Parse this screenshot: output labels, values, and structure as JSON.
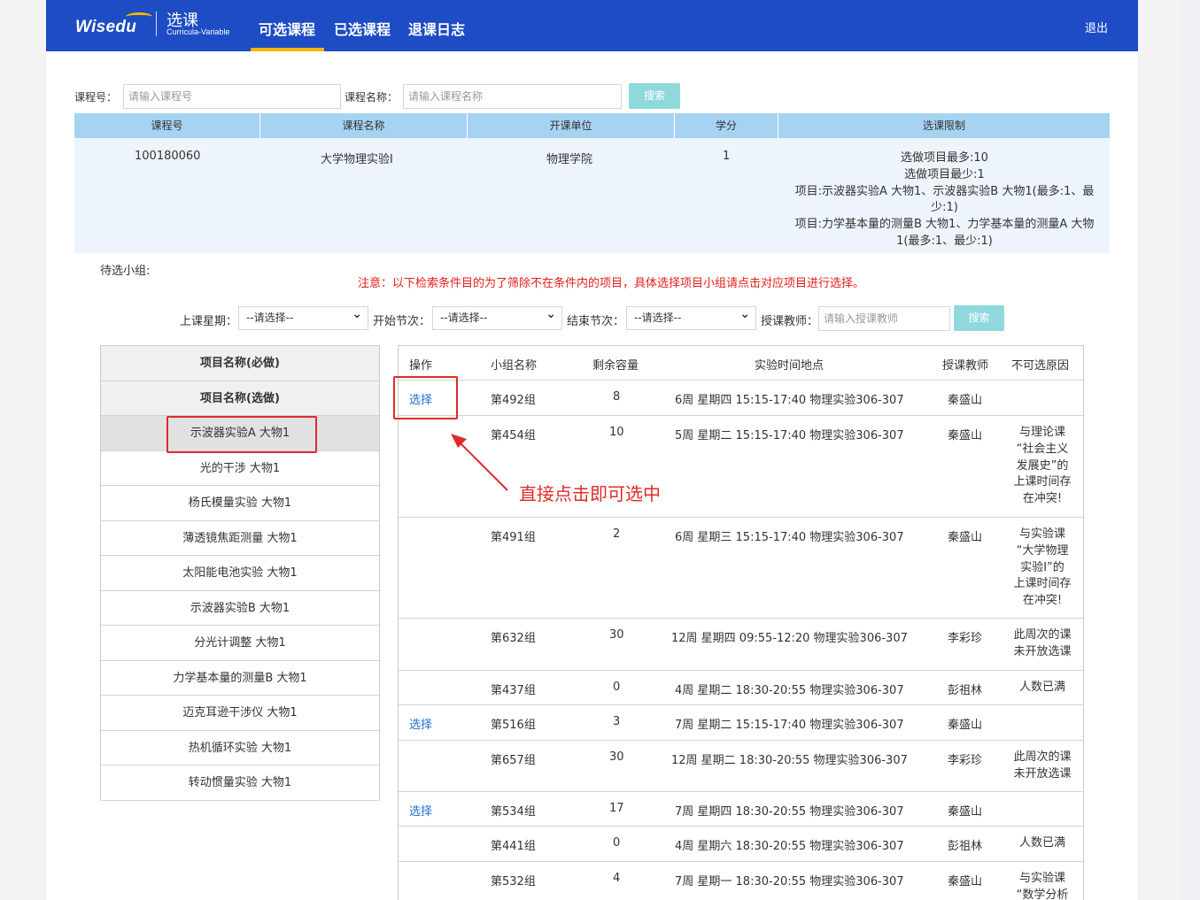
{
  "header": {
    "logo": "Wisedu",
    "app_title": "选课",
    "app_subtitle": "Curricula-Variable",
    "nav": [
      "可选课程",
      "已选课程",
      "退课日志"
    ],
    "logout": "退出"
  },
  "search": {
    "course_no_label": "课程号：",
    "course_no_placeholder": "请输入课程号",
    "course_name_label": "课程名称：",
    "course_name_placeholder": "请输入课程名称",
    "search_button": "搜索"
  },
  "course_table": {
    "headers": [
      "课程号",
      "课程名称",
      "开课单位",
      "学分",
      "选课限制"
    ],
    "row": {
      "course_no": "100180060",
      "course_name": "大学物理实验Ⅰ",
      "unit": "物理学院",
      "credit": "1",
      "limits": [
        "选做项目最多:10",
        "选做项目最少:1",
        "项目:示波器实验A 大物1、示波器实验B 大物1(最多:1、最",
        "少:1)",
        "项目:力学基本量的测量B 大物1、力学基本量的测量A 大物",
        "1(最多:1、最少:1)"
      ]
    }
  },
  "groups_label": "待选小组:",
  "notice": "注意：以下检索条件目的为了筛除不在条件内的项目，具体选择项目小组请点击对应项目进行选择。",
  "filters": {
    "weekday_label": "上课星期：",
    "weekday_value": "--请选择--",
    "start_label": "开始节次：",
    "start_value": "--请选择--",
    "end_label": "结束节次：",
    "end_value": "--请选择--",
    "teacher_label": "授课教师：",
    "teacher_placeholder": "请输入授课教师",
    "search_button": "搜索"
  },
  "projects": {
    "required_header": "项目名称(必做)",
    "optional_header": "项目名称(选做)",
    "items": [
      "示波器实验A 大物1",
      "光的干涉 大物1",
      "杨氏模量实验 大物1",
      "薄透镜焦距测量 大物1",
      "太阳能电池实验 大物1",
      "示波器实验B 大物1",
      "分光计调整 大物1",
      "力学基本量的测量B 大物1",
      "迈克耳逊干涉仪 大物1",
      "热机循环实验 大物1",
      "转动惯量实验 大物1"
    ]
  },
  "groups_table": {
    "headers": [
      "操作",
      "小组名称",
      "剩余容量",
      "实验时间地点",
      "授课教师",
      "不可选原因"
    ],
    "rows": [
      {
        "action": "选择",
        "name": "第492组",
        "capacity": "8",
        "time": "6周 星期四 15:15-17:40 物理实验306-307",
        "teacher": "秦盛山",
        "reason": []
      },
      {
        "action": "",
        "name": "第454组",
        "capacity": "10",
        "time": "5周 星期二 15:15-17:40 物理实验306-307",
        "teacher": "秦盛山",
        "reason": [
          "与理论课",
          "“社会主义",
          "发展史”的",
          "上课时间存",
          "在冲突!"
        ]
      },
      {
        "action": "",
        "name": "第491组",
        "capacity": "2",
        "time": "6周 星期三 15:15-17:40 物理实验306-307",
        "teacher": "秦盛山",
        "reason": [
          "与实验课",
          "“大学物理",
          "实验Ⅰ”的",
          "上课时间存",
          "在冲突!"
        ]
      },
      {
        "action": "",
        "name": "第632组",
        "capacity": "30",
        "time": "12周 星期四 09:55-12:20 物理实验306-307",
        "teacher": "李彩珍",
        "reason": [
          "此周次的课",
          "未开放选课"
        ]
      },
      {
        "action": "",
        "name": "第437组",
        "capacity": "0",
        "time": "4周 星期二 18:30-20:55 物理实验306-307",
        "teacher": "彭祖林",
        "reason": [
          "人数已满"
        ]
      },
      {
        "action": "选择",
        "name": "第516组",
        "capacity": "3",
        "time": "7周 星期二 15:15-17:40 物理实验306-307",
        "teacher": "秦盛山",
        "reason": []
      },
      {
        "action": "",
        "name": "第657组",
        "capacity": "30",
        "time": "12周 星期二 18:30-20:55 物理实验306-307",
        "teacher": "李彩珍",
        "reason": [
          "此周次的课",
          "未开放选课"
        ]
      },
      {
        "action": "选择",
        "name": "第534组",
        "capacity": "17",
        "time": "7周 星期四 18:30-20:55 物理实验306-307",
        "teacher": "秦盛山",
        "reason": []
      },
      {
        "action": "",
        "name": "第441组",
        "capacity": "0",
        "time": "4周 星期六 18:30-20:55 物理实验306-307",
        "teacher": "彭祖林",
        "reason": [
          "人数已满"
        ]
      },
      {
        "action": "",
        "name": "第532组",
        "capacity": "4",
        "time": "7周 星期一 18:30-20:55 物理实验306-307",
        "teacher": "秦盛山",
        "reason": [
          "与实验课",
          "“数学分析"
        ]
      }
    ]
  },
  "annotation": "直接点击即可选中",
  "colors": {
    "brand": "#1d4cc4",
    "accent": "#f5b400",
    "table_header": "#a7d3f3",
    "warning": "#e0201c",
    "link": "#1f6fd1"
  }
}
